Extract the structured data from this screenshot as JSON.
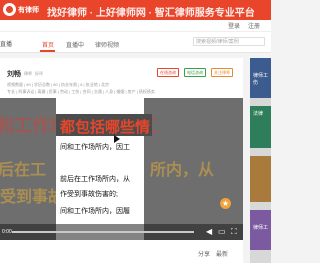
{
  "header": {
    "logo": "有律师",
    "slogan": "找好律师 · 上好律师网 · 智汇律师服务专业平台"
  },
  "secondbar": {
    "login": "登录",
    "register": "注册"
  },
  "nav": {
    "left_label": "直播",
    "tabs": [
      "首页",
      "直播中",
      "律师视频"
    ],
    "search_placeholder": "搜索视频/律师/案例"
  },
  "card": {
    "name": "刘畅",
    "badge": "律师",
    "rating": "好评",
    "meta1": "视频数量 | 80 | 学历总数 | 80 | 执业年限 | 8 | 执业地 | 北京",
    "meta2": "专长 | 刑事诉讼 | 离婚 | 民事 | 劳动 | 工伤 | 合同 | 交通 | 人身 | 婚姻 | 房产 | 债权债务",
    "btn1": "在线咨询",
    "btn2": "电话咨询",
    "btn3": "关注律师"
  },
  "video": {
    "overlay_line1": "和工作场所内，因工",
    "overlay_line2_left": "后在工",
    "overlay_line2_right": "所内，从",
    "overlay_line3": "受到事故伤害的",
    "poster_title": "都包括哪些情",
    "poster_line1": "间和工作场所内，因工",
    "poster_line2": "前后在工作场所内，从",
    "poster_line3": "作受到事故伤害的;",
    "poster_line4": "间和工作场所内，因履",
    "time": "0:00"
  },
  "rightpanel": {
    "label": "律师工伤",
    "tag": "法律",
    "label2": "律师工"
  },
  "bottom": {
    "share": "分享",
    "latest": "最新"
  }
}
